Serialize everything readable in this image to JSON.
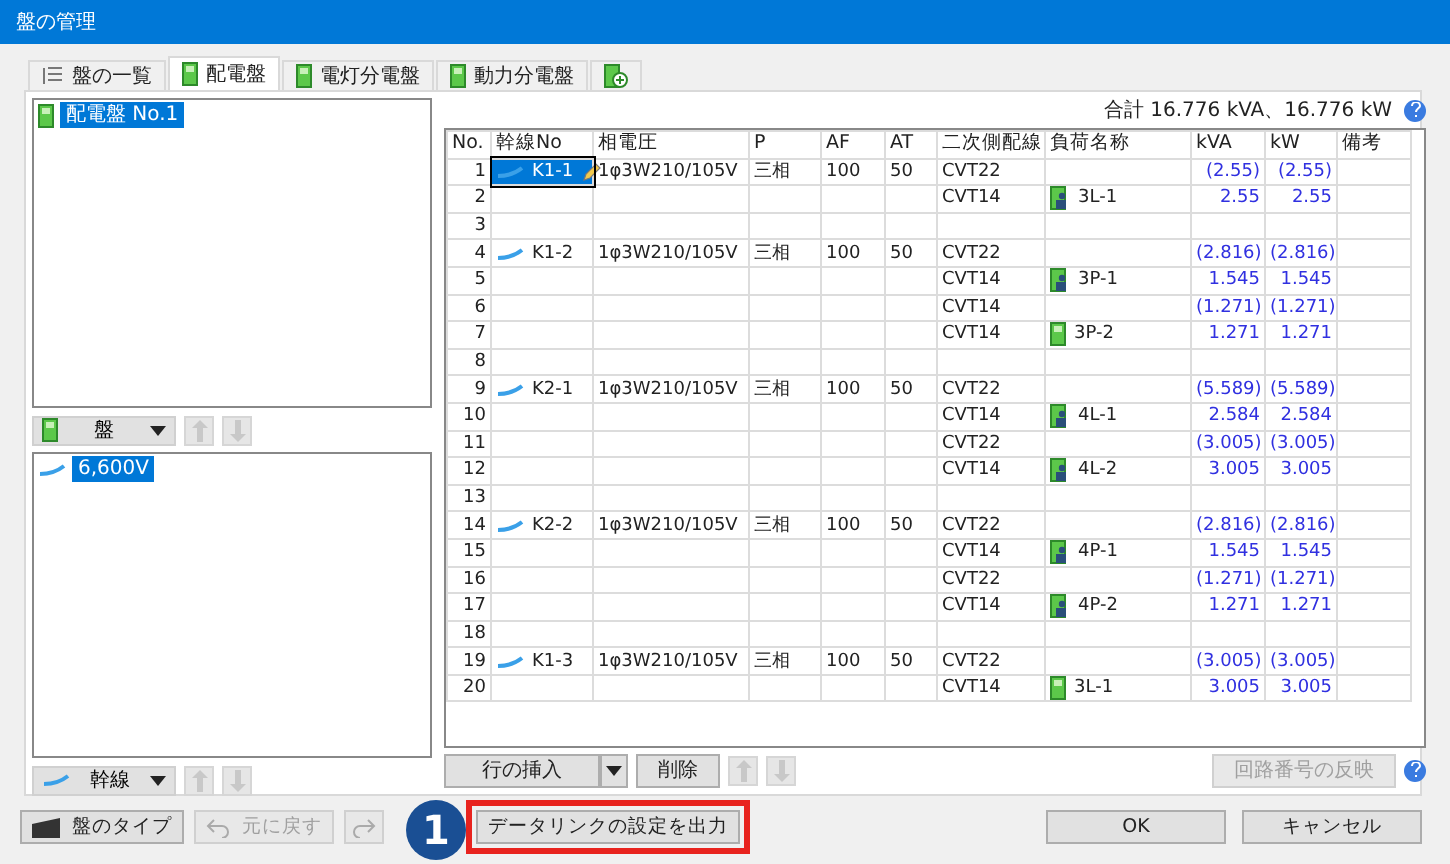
{
  "window": {
    "title": "盤の管理"
  },
  "tabs": [
    {
      "label": "盤の一覧",
      "kind": "list",
      "selected": false
    },
    {
      "label": "配電盤",
      "kind": "panel",
      "selected": true
    },
    {
      "label": "電灯分電盤",
      "kind": "panel",
      "selected": false
    },
    {
      "label": "動力分電盤",
      "kind": "panel",
      "selected": false
    },
    {
      "kind": "add",
      "selected": false
    }
  ],
  "panel_tree": {
    "items": [
      {
        "label": "配電盤 No.1",
        "selected": true
      }
    ]
  },
  "panel_toolbar": {
    "dropdown": "盤",
    "kind": "panel",
    "buttons": [
      {
        "kind": "up",
        "disabled": true
      },
      {
        "kind": "down",
        "disabled": true
      }
    ]
  },
  "voltage_tree": {
    "items": [
      {
        "label": "6,600V",
        "selected": true
      }
    ]
  },
  "trunk_toolbar": {
    "dropdown": "幹線",
    "kind": "line",
    "buttons": [
      {
        "kind": "up",
        "disabled": true
      },
      {
        "kind": "down",
        "disabled": true
      }
    ]
  },
  "total": "合計 16.776 kVA、16.776 kW",
  "table": {
    "columns": [
      "No.",
      "幹線No",
      "相電圧",
      "P",
      "AF",
      "AT",
      "二次側配線",
      "負荷名称",
      "kVA",
      "kW",
      "備考"
    ],
    "rows": [
      {
        "no": "1",
        "trunk": {
          "label": "K1-1",
          "selected": true
        },
        "voltage": "1φ3W210/105V",
        "phase": "三相",
        "af": "100",
        "at": "50",
        "wiring": "CVT22",
        "kva": "(2.55)",
        "kw": "(2.55)"
      },
      {
        "no": "2",
        "wiring": "CVT14",
        "load": {
          "label": "3L-1",
          "kind": "person"
        },
        "kva": "2.55",
        "kw": "2.55"
      },
      {
        "no": "3"
      },
      {
        "no": "4",
        "trunk": {
          "label": "K1-2",
          "selected": false
        },
        "voltage": "1φ3W210/105V",
        "phase": "三相",
        "af": "100",
        "at": "50",
        "wiring": "CVT22",
        "kva": "(2.816)",
        "kw": "(2.816)"
      },
      {
        "no": "5",
        "wiring": "CVT14",
        "load": {
          "label": "3P-1",
          "kind": "person"
        },
        "kva": "1.545",
        "kw": "1.545"
      },
      {
        "no": "6",
        "wiring": "CVT14",
        "kva": "(1.271)",
        "kw": "(1.271)"
      },
      {
        "no": "7",
        "wiring": "CVT14",
        "load": {
          "label": "3P-2",
          "kind": "plain"
        },
        "kva": "1.271",
        "kw": "1.271"
      },
      {
        "no": "8"
      },
      {
        "no": "9",
        "trunk": {
          "label": "K2-1",
          "selected": false
        },
        "voltage": "1φ3W210/105V",
        "phase": "三相",
        "af": "100",
        "at": "50",
        "wiring": "CVT22",
        "kva": "(5.589)",
        "kw": "(5.589)"
      },
      {
        "no": "10",
        "wiring": "CVT14",
        "load": {
          "label": "4L-1",
          "kind": "person"
        },
        "kva": "2.584",
        "kw": "2.584"
      },
      {
        "no": "11",
        "wiring": "CVT22",
        "kva": "(3.005)",
        "kw": "(3.005)"
      },
      {
        "no": "12",
        "wiring": "CVT14",
        "load": {
          "label": "4L-2",
          "kind": "person"
        },
        "kva": "3.005",
        "kw": "3.005"
      },
      {
        "no": "13"
      },
      {
        "no": "14",
        "trunk": {
          "label": "K2-2",
          "selected": false
        },
        "voltage": "1φ3W210/105V",
        "phase": "三相",
        "af": "100",
        "at": "50",
        "wiring": "CVT22",
        "kva": "(2.816)",
        "kw": "(2.816)"
      },
      {
        "no": "15",
        "wiring": "CVT14",
        "load": {
          "label": "4P-1",
          "kind": "person"
        },
        "kva": "1.545",
        "kw": "1.545"
      },
      {
        "no": "16",
        "wiring": "CVT22",
        "kva": "(1.271)",
        "kw": "(1.271)"
      },
      {
        "no": "17",
        "wiring": "CVT14",
        "load": {
          "label": "4P-2",
          "kind": "person"
        },
        "kva": "1.271",
        "kw": "1.271"
      },
      {
        "no": "18"
      },
      {
        "no": "19",
        "trunk": {
          "label": "K1-3",
          "selected": false
        },
        "voltage": "1φ3W210/105V",
        "phase": "三相",
        "af": "100",
        "at": "50",
        "wiring": "CVT22",
        "kva": "(3.005)",
        "kw": "(3.005)"
      },
      {
        "no": "20",
        "wiring": "CVT14",
        "load": {
          "label": "3L-1",
          "kind": "plain"
        },
        "kva": "3.005",
        "kw": "3.005"
      }
    ]
  },
  "table_toolbar": {
    "insert": "行の挿入",
    "delete": "削除",
    "buttons": [
      {
        "kind": "up",
        "disabled": true
      },
      {
        "kind": "down",
        "disabled": true
      }
    ],
    "apply": {
      "label": "回路番号の反映",
      "disabled": true
    }
  },
  "footer": {
    "buttons": [
      {
        "label": "盤のタイプ",
        "kind": "type",
        "disabled": false
      },
      {
        "label": "元に戻す",
        "kind": "undo",
        "disabled": true
      },
      {
        "kind": "redo",
        "disabled": true
      },
      {
        "label": "データリンクの設定を出力",
        "kind": "plain",
        "disabled": false,
        "highlighted": true
      }
    ],
    "ok": "OK",
    "cancel": "キャンセル"
  },
  "callout": {
    "label": "1"
  }
}
